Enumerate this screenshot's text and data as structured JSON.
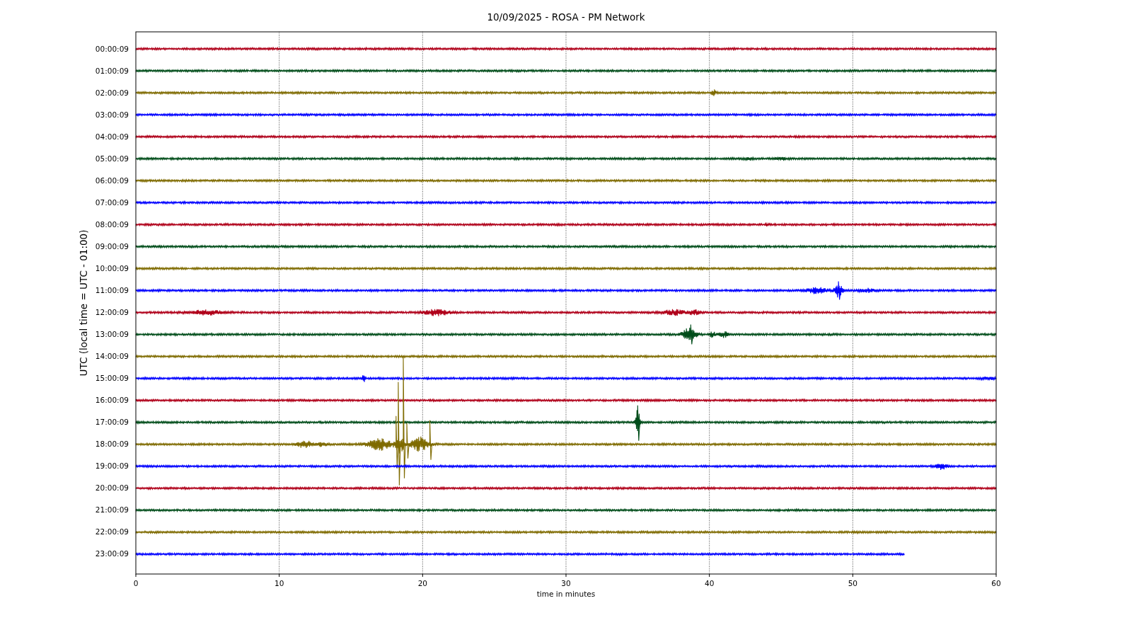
{
  "figure": {
    "title": "10/09/2025 - ROSA - PM Network",
    "ylabel": "UTC (local time = UTC - 01:00)",
    "xlabel": "time in minutes",
    "xticks": [
      "0",
      "10",
      "20",
      "30",
      "40",
      "50",
      "60"
    ],
    "traces": [
      {
        "label": "00:00:09",
        "color": "#b0001a"
      },
      {
        "label": "01:00:09",
        "color": "#004d1a"
      },
      {
        "label": "02:00:09",
        "color": "#7f6b00"
      },
      {
        "label": "03:00:09",
        "color": "#0000ff"
      },
      {
        "label": "04:00:09",
        "color": "#b0001a"
      },
      {
        "label": "05:00:09",
        "color": "#004d1a"
      },
      {
        "label": "06:00:09",
        "color": "#7f6b00"
      },
      {
        "label": "07:00:09",
        "color": "#0000ff"
      },
      {
        "label": "08:00:09",
        "color": "#b0001a"
      },
      {
        "label": "09:00:09",
        "color": "#004d1a"
      },
      {
        "label": "10:00:09",
        "color": "#7f6b00"
      },
      {
        "label": "11:00:09",
        "color": "#0000ff"
      },
      {
        "label": "12:00:09",
        "color": "#b0001a"
      },
      {
        "label": "13:00:09",
        "color": "#004d1a"
      },
      {
        "label": "14:00:09",
        "color": "#7f6b00"
      },
      {
        "label": "15:00:09",
        "color": "#0000ff"
      },
      {
        "label": "16:00:09",
        "color": "#b0001a"
      },
      {
        "label": "17:00:09",
        "color": "#004d1a"
      },
      {
        "label": "18:00:09",
        "color": "#7f6b00"
      },
      {
        "label": "19:00:09",
        "color": "#0000ff"
      },
      {
        "label": "20:00:09",
        "color": "#b0001a"
      },
      {
        "label": "21:00:09",
        "color": "#004d1a"
      },
      {
        "label": "22:00:09",
        "color": "#7f6b00"
      },
      {
        "label": "23:00:09",
        "color": "#0000ff"
      }
    ]
  }
}
